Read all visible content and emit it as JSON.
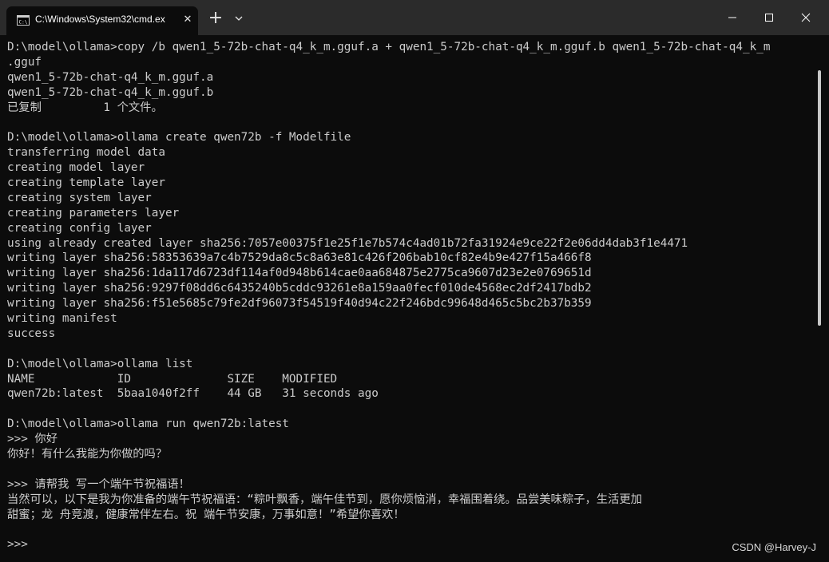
{
  "window": {
    "tab_title": "C:\\Windows\\System32\\cmd.ex",
    "tab_icon": "cmd-icon",
    "close_tab_icon": "close-icon",
    "new_tab_icon": "plus-icon",
    "dropdown_icon": "chevron-down-icon",
    "minimize_icon": "minimize-icon",
    "maximize_icon": "maximize-icon",
    "close_icon": "close-icon",
    "colors": {
      "titlebar": "#2b2b2b",
      "background": "#0c0c0c",
      "text": "#cccccc"
    }
  },
  "console": {
    "lines": [
      "D:\\model\\ollama>copy /b qwen1_5-72b-chat-q4_k_m.gguf.a + qwen1_5-72b-chat-q4_k_m.gguf.b qwen1_5-72b-chat-q4_k_m",
      ".gguf",
      "qwen1_5-72b-chat-q4_k_m.gguf.a",
      "qwen1_5-72b-chat-q4_k_m.gguf.b",
      "已复制         1 个文件。",
      "",
      "D:\\model\\ollama>ollama create qwen72b -f Modelfile",
      "transferring model data",
      "creating model layer",
      "creating template layer",
      "creating system layer",
      "creating parameters layer",
      "creating config layer",
      "using already created layer sha256:7057e00375f1e25f1e7b574c4ad01b72fa31924e9ce22f2e06dd4dab3f1e4471",
      "writing layer sha256:58353639a7c4b7529da8c5c8a63e81c426f206bab10cf82e4b9e427f15a466f8",
      "writing layer sha256:1da117d6723df114af0d948b614cae0aa684875e2775ca9607d23e2e0769651d",
      "writing layer sha256:9297f08dd6c6435240b5cddc93261e8a159aa0fecf010de4568ec2df2417bdb2",
      "writing layer sha256:f51e5685c79fe2df96073f54519f40d94c22f246bdc99648d465c5bc2b37b359",
      "writing manifest",
      "success",
      "",
      "D:\\model\\ollama>ollama list",
      "NAME            ID              SIZE    MODIFIED",
      "qwen72b:latest  5baa1040f2ff    44 GB   31 seconds ago",
      "",
      "D:\\model\\ollama>ollama run qwen72b:latest",
      ">>> 你好",
      "你好！有什么我能为你做的吗？",
      "",
      ">>> 请帮我 写一个端午节祝福语！",
      "当然可以，以下是我为你准备的端午节祝福语：“粽叶飘香，端午佳节到，愿你烦恼消，幸福围着绕。品尝美味粽子，生活更加",
      "甜蜜；龙 舟竞渡，健康常伴左右。祝 端午节安康，万事如意！”希望你喜欢！",
      "",
      ">>>"
    ]
  },
  "watermark": "CSDN @Harvey-J"
}
